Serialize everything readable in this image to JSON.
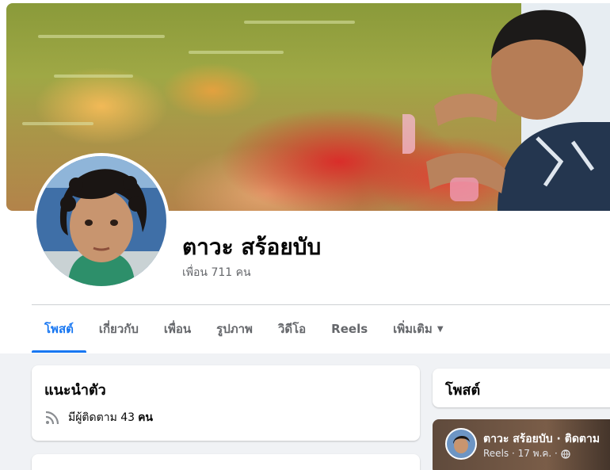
{
  "profile": {
    "name": "ตาวะ สร้อยบับ",
    "friends": "เพื่อน 711 คน"
  },
  "tabs": [
    {
      "label": "โพสต์",
      "active": true
    },
    {
      "label": "เกี่ยวกับ"
    },
    {
      "label": "เพื่อน"
    },
    {
      "label": "รูปภาพ"
    },
    {
      "label": "วิดีโอ"
    },
    {
      "label": "Reels"
    },
    {
      "label": "เพิ่มเติม"
    }
  ],
  "intro": {
    "title": "แนะนำตัว",
    "followers_text": "มีผู้ติดตาม 43",
    "followers_unit": "คน"
  },
  "posts_section": {
    "title": "โพสต์"
  },
  "reel_post": {
    "author_line": "ตาวะ สร้อยบับ · ติดตาม",
    "meta": "Reels · 17 พ.ค. ·"
  },
  "icons": {
    "followers": "rss-feed-icon",
    "more_tab": "caret-down-icon",
    "privacy": "globe-icon"
  },
  "colors": {
    "accent": "#1877f2",
    "secondary_text": "#65676b",
    "page_bg": "#f0f2f5"
  }
}
